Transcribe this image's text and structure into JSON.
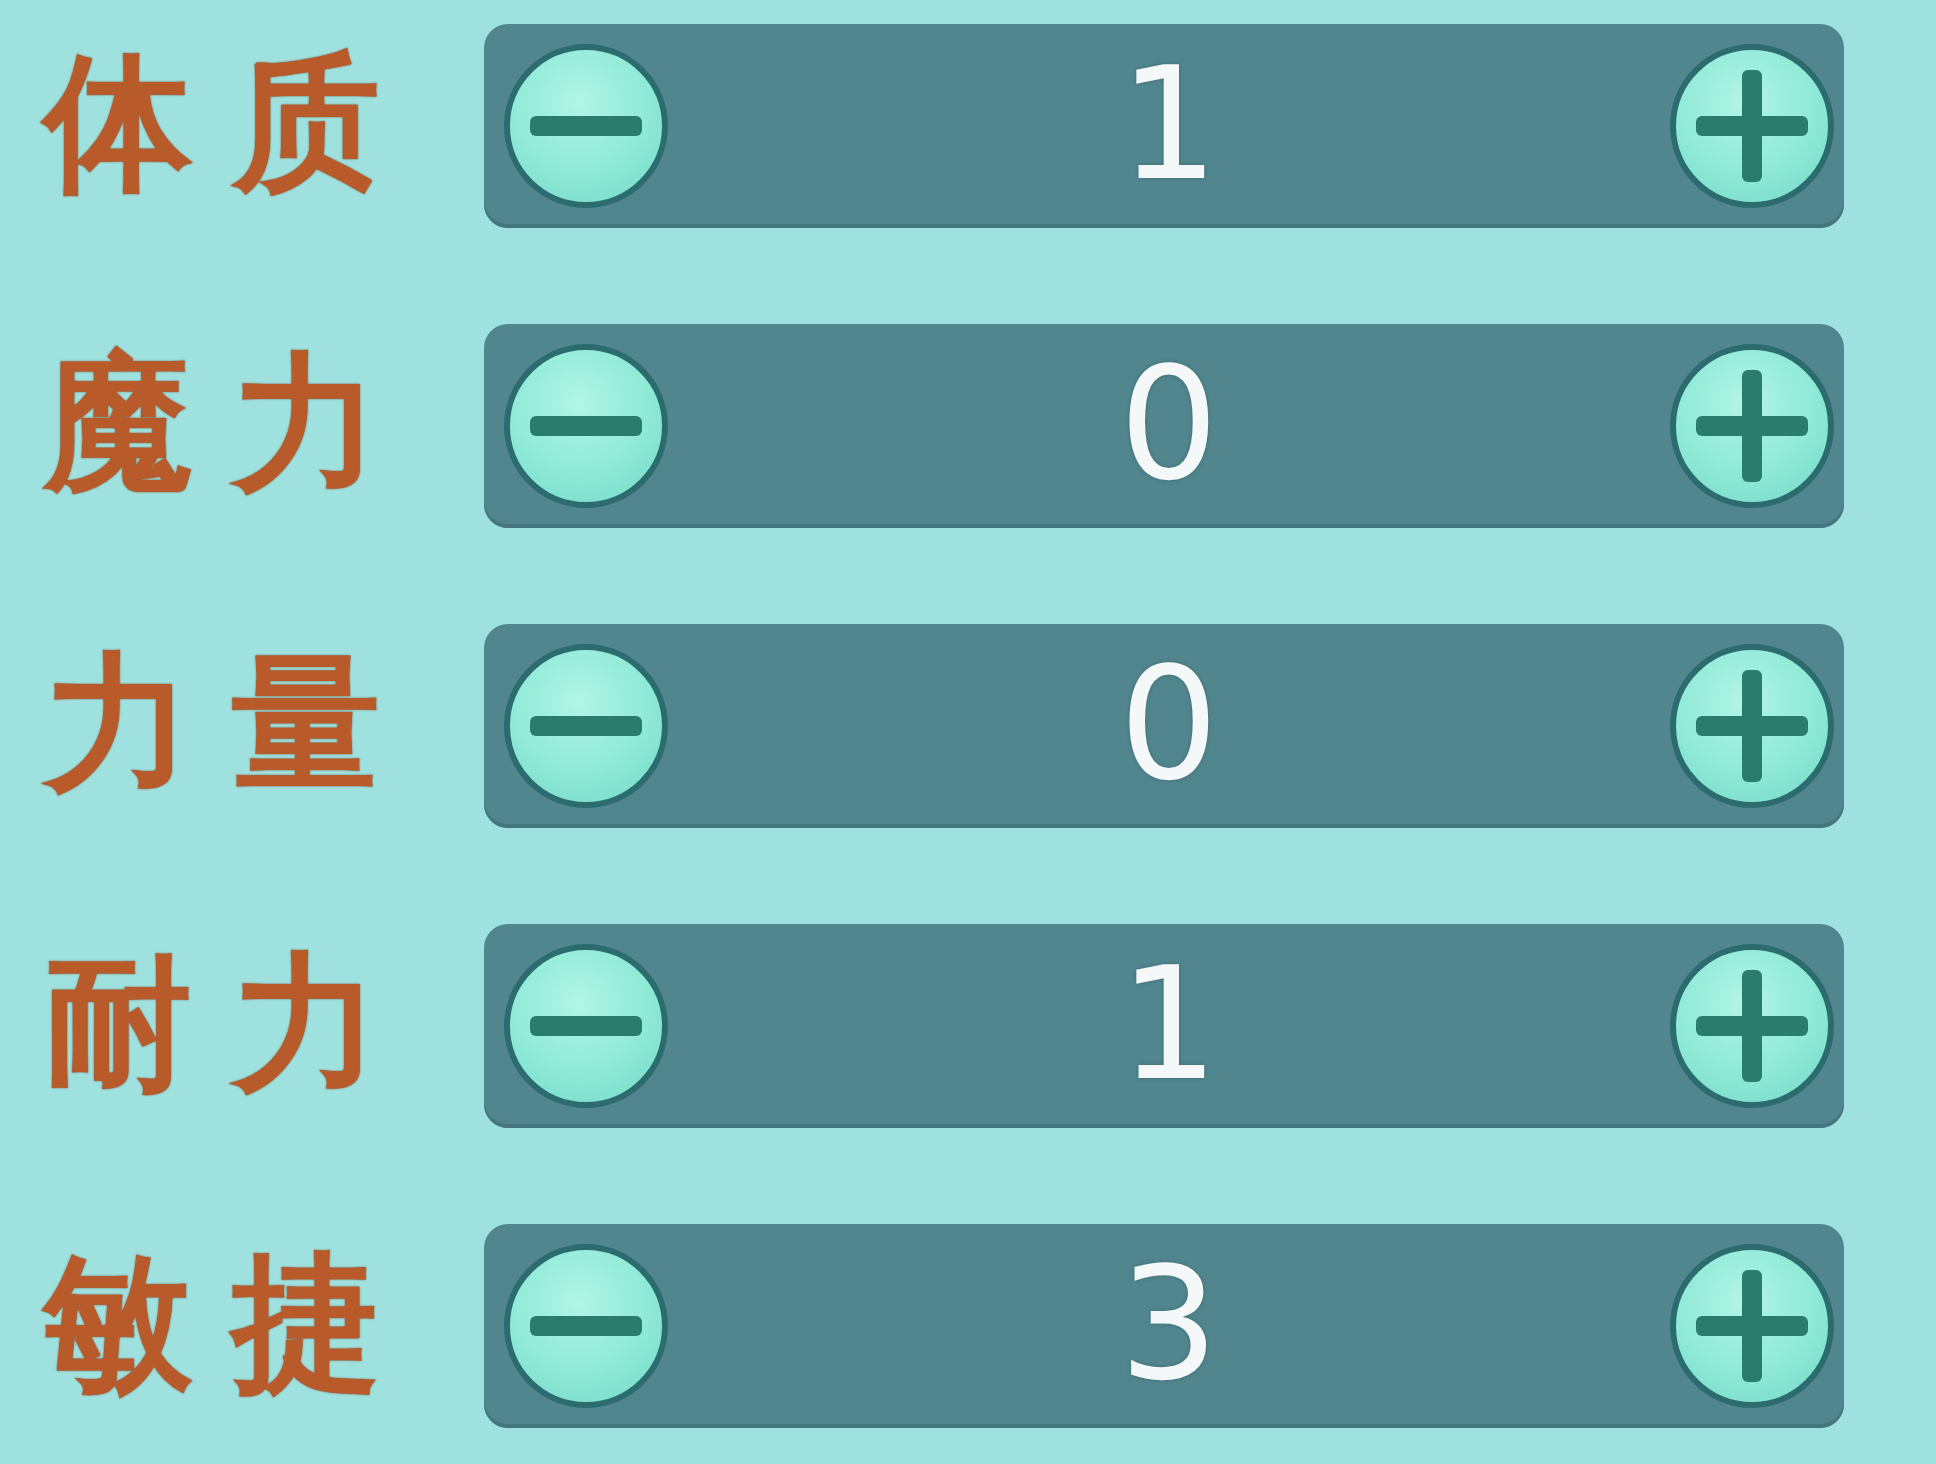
{
  "stats": [
    {
      "label": "体质",
      "value": "1"
    },
    {
      "label": "魔力",
      "value": "0"
    },
    {
      "label": "力量",
      "value": "0"
    },
    {
      "label": "耐力",
      "value": "1"
    },
    {
      "label": "敏捷",
      "value": "3"
    }
  ]
}
